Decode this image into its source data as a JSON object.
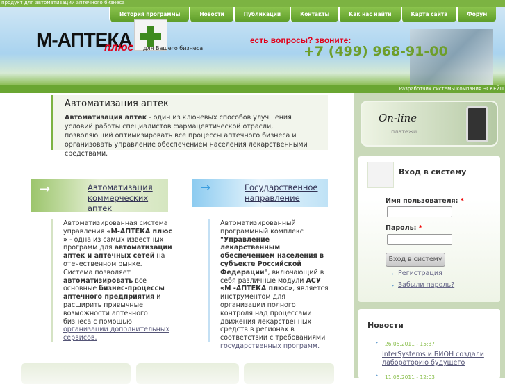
{
  "topbar": {
    "tagline": "продукт для автоматизации аптечного бизнеса"
  },
  "nav": [
    "История программы",
    "Новости",
    "Публикации",
    "Контакты",
    "Как нас найти",
    "Карта сайта",
    "Форум"
  ],
  "header": {
    "logo": "М-АПТЕКА",
    "logo_plus": "плюс",
    "logo_tagline": "для Вашего бизнеса",
    "question": "есть вопросы? звоните:",
    "phone": "+7 (499) 968-91-00",
    "developer": "Разработчик системы  компания ЭСКЕЙП"
  },
  "intro": {
    "title": "Автоматизация аптек",
    "bold": "Автоматизация аптек",
    "text": " - один из ключевых способов улучшения условий работы специалистов фармацевтической отрасли, позволяющий оптимизировать все процессы аптечного бизнеса и организовать управление обеспечением населения лекарственными средствами."
  },
  "col1": {
    "title": "Автоматизация коммерческих аптек",
    "t1": "Автоматизированная система управления ",
    "b1": "«М-АПТЕКА плюс »",
    "t2": " - одна из самых известных программ для ",
    "b2": "автоматизации аптек и аптечных сетей",
    "t3": " на отечественном рынке. Система позволяет ",
    "b3": "автоматизировать",
    "t4": " все основные ",
    "b4": "бизнес-процессы аптечного предприятия",
    "t5": " и расширить привычные возможности аптечного бизнеса с помощью ",
    "link": "организации дополнительных сервисов."
  },
  "col2": {
    "title": "Государственное направление",
    "t1": "Автоматизированный программный комплекс ",
    "b1": "\"Управление лекарственным обеспечением населения в субъекте Российской Федерации\"",
    "t2": ", включающий в себя различные модули ",
    "b2": "АСУ «М -АПТЕКА плюс»",
    "t3": ", является инструментом для организации полного контроля над процессами движения лекарственных средств в регионах в соответствии с требованиями ",
    "link": "государственных программ."
  },
  "online": {
    "logo": "On-line",
    "sub": "платежи"
  },
  "login": {
    "title": "Вход в систему",
    "user_label": "Имя пользователя:",
    "pass_label": "Пароль:",
    "required": "*",
    "username": "",
    "password": "",
    "submit": "Вход в систему",
    "register": "Регистрация",
    "forgot": "Забыли пароль?"
  },
  "news": {
    "title": "Новости",
    "items": [
      {
        "date": "26.05.2011 - 15:37",
        "title": "InterSystems и БИОН создали лабораторию будущего"
      },
      {
        "date": "11.05.2011 - 12:03"
      }
    ]
  }
}
